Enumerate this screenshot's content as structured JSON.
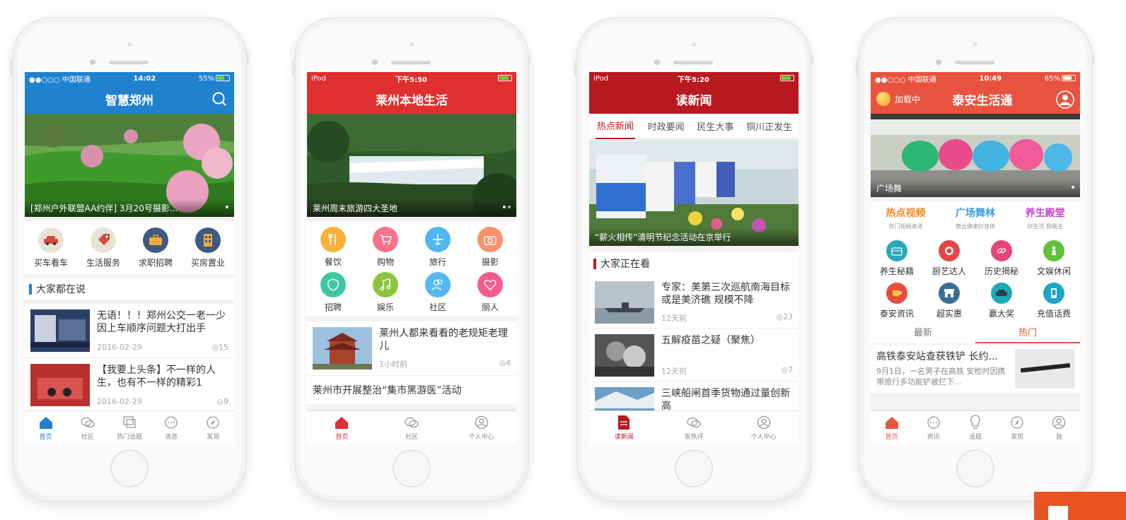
{
  "phones": [
    {
      "status": {
        "left": "●●○○○ 中国联通",
        "time": "14:02",
        "right": "55%"
      },
      "title": "智慧郑州",
      "banner_caption": "[郑州户外联盟AA约伴] 3月20号摄影...",
      "shortcuts": [
        {
          "label": "买车看车",
          "icon": "car-icon"
        },
        {
          "label": "生活服务",
          "icon": "tag-icon"
        },
        {
          "label": "求职招聘",
          "icon": "briefcase-icon"
        },
        {
          "label": "买房置业",
          "icon": "building-icon"
        }
      ],
      "section": "大家都在说",
      "news": [
        {
          "title": "无语！！！郑州公交一老一少因上车顺序问题大打出手",
          "date": "2016-02-29",
          "views": "15"
        },
        {
          "title": "【我要上头条】不一样的人生，也有不一样的精彩1",
          "date": "2016-02-29",
          "views": "9"
        }
      ],
      "tabs": [
        "首页",
        "社区",
        "热门话题",
        "消息",
        "发现"
      ],
      "accent": "#1f82cf"
    },
    {
      "status": {
        "left": "iPod",
        "time": "下午5:50",
        "right": ""
      },
      "title": "莱州本地生活",
      "banner_caption": "莱州周末旅游四大圣地",
      "categories": [
        {
          "label": "餐饮",
          "icon": "fork-icon",
          "color": "#f7b23b"
        },
        {
          "label": "购物",
          "icon": "cart-icon",
          "color": "#f4738a"
        },
        {
          "label": "旅行",
          "icon": "plane-icon",
          "color": "#4fb8f0"
        },
        {
          "label": "摄影",
          "icon": "camera-icon",
          "color": "#fb8f6e"
        },
        {
          "label": "招聘",
          "icon": "shield-icon",
          "color": "#3fc6a2"
        },
        {
          "label": "娱乐",
          "icon": "music-icon",
          "color": "#8cc63f"
        },
        {
          "label": "社区",
          "icon": "people-icon",
          "color": "#56b9f0"
        },
        {
          "label": "丽人",
          "icon": "heart-icon",
          "color": "#f35c8e"
        }
      ],
      "news": [
        {
          "title": "莱州人都来看看的老规矩老理儿",
          "date": "1小时前",
          "views": "4"
        }
      ],
      "single_line": "莱州市开展整治“集市黑游医”活动",
      "tabs": [
        "首页",
        "社区",
        "个人中心"
      ],
      "accent": "#e02f2f"
    },
    {
      "status": {
        "left": "iPod",
        "time": "下午5:20",
        "right": ""
      },
      "title": "读新闻",
      "channels": [
        "热点新闻",
        "时政要闻",
        "民生大事",
        "铜川正发生"
      ],
      "banner_caption": "“薪火相传”清明节纪念活动在京举行",
      "section": "大家正在看",
      "news": [
        {
          "title": "专家：美第三次巡航南海目标或是美济礁 规模不降",
          "date": "12天前",
          "views": "23"
        },
        {
          "title": "五解疫苗之疑（聚焦）",
          "date": "12天前",
          "views": "7"
        },
        {
          "title": "三峡船闸首季货物通过量创新高",
          "date": "",
          "views": ""
        }
      ],
      "tabs": [
        "读新闻",
        "发热评",
        "个人中心"
      ],
      "accent": "#b8191f"
    },
    {
      "status": {
        "left": "●●○○○ 中国联通",
        "time": "10:49",
        "right": "65%"
      },
      "title": "泰安生活通",
      "loading": "加载中",
      "banner_caption": "广场舞",
      "features": [
        {
          "title": "热点视频",
          "sub": "热门视频速递",
          "color": "#f08a24"
        },
        {
          "title": "广场舞林",
          "sub": "舞出健康好身体",
          "color": "#3a9be0"
        },
        {
          "title": "养生殿堂",
          "sub": "好生活 我做主",
          "color": "#c744c9"
        }
      ],
      "services": [
        {
          "label": "养生秘籍",
          "icon": "bag-icon",
          "color": "#2aa7b8"
        },
        {
          "label": "厨艺达人",
          "icon": "plate-icon",
          "color": "#e64545"
        },
        {
          "label": "历史揭秘",
          "icon": "link-icon",
          "color": "#e8437a"
        },
        {
          "label": "文娱休闲",
          "icon": "chess-icon",
          "color": "#62c13a"
        },
        {
          "label": "泰安资讯",
          "icon": "cup-icon",
          "color": "#e84d3d"
        },
        {
          "label": "超实惠",
          "icon": "store-icon",
          "color": "#3a6f96"
        },
        {
          "label": "赢大奖",
          "icon": "car-icon",
          "color": "#1da9b5"
        },
        {
          "label": "充值话费",
          "icon": "phone-icon",
          "color": "#1ca5c4"
        }
      ],
      "segments": [
        "最新",
        "热门"
      ],
      "news": [
        {
          "title": "高铁泰安站查获铁铲 长约...",
          "desc": "9月1日，一名男子在高铁 安检时因携带旅行多功能铲被拦下..."
        }
      ],
      "tabs": [
        "首页",
        "资讯",
        "话题",
        "发现",
        "我"
      ],
      "accent": "#e8533f"
    }
  ]
}
